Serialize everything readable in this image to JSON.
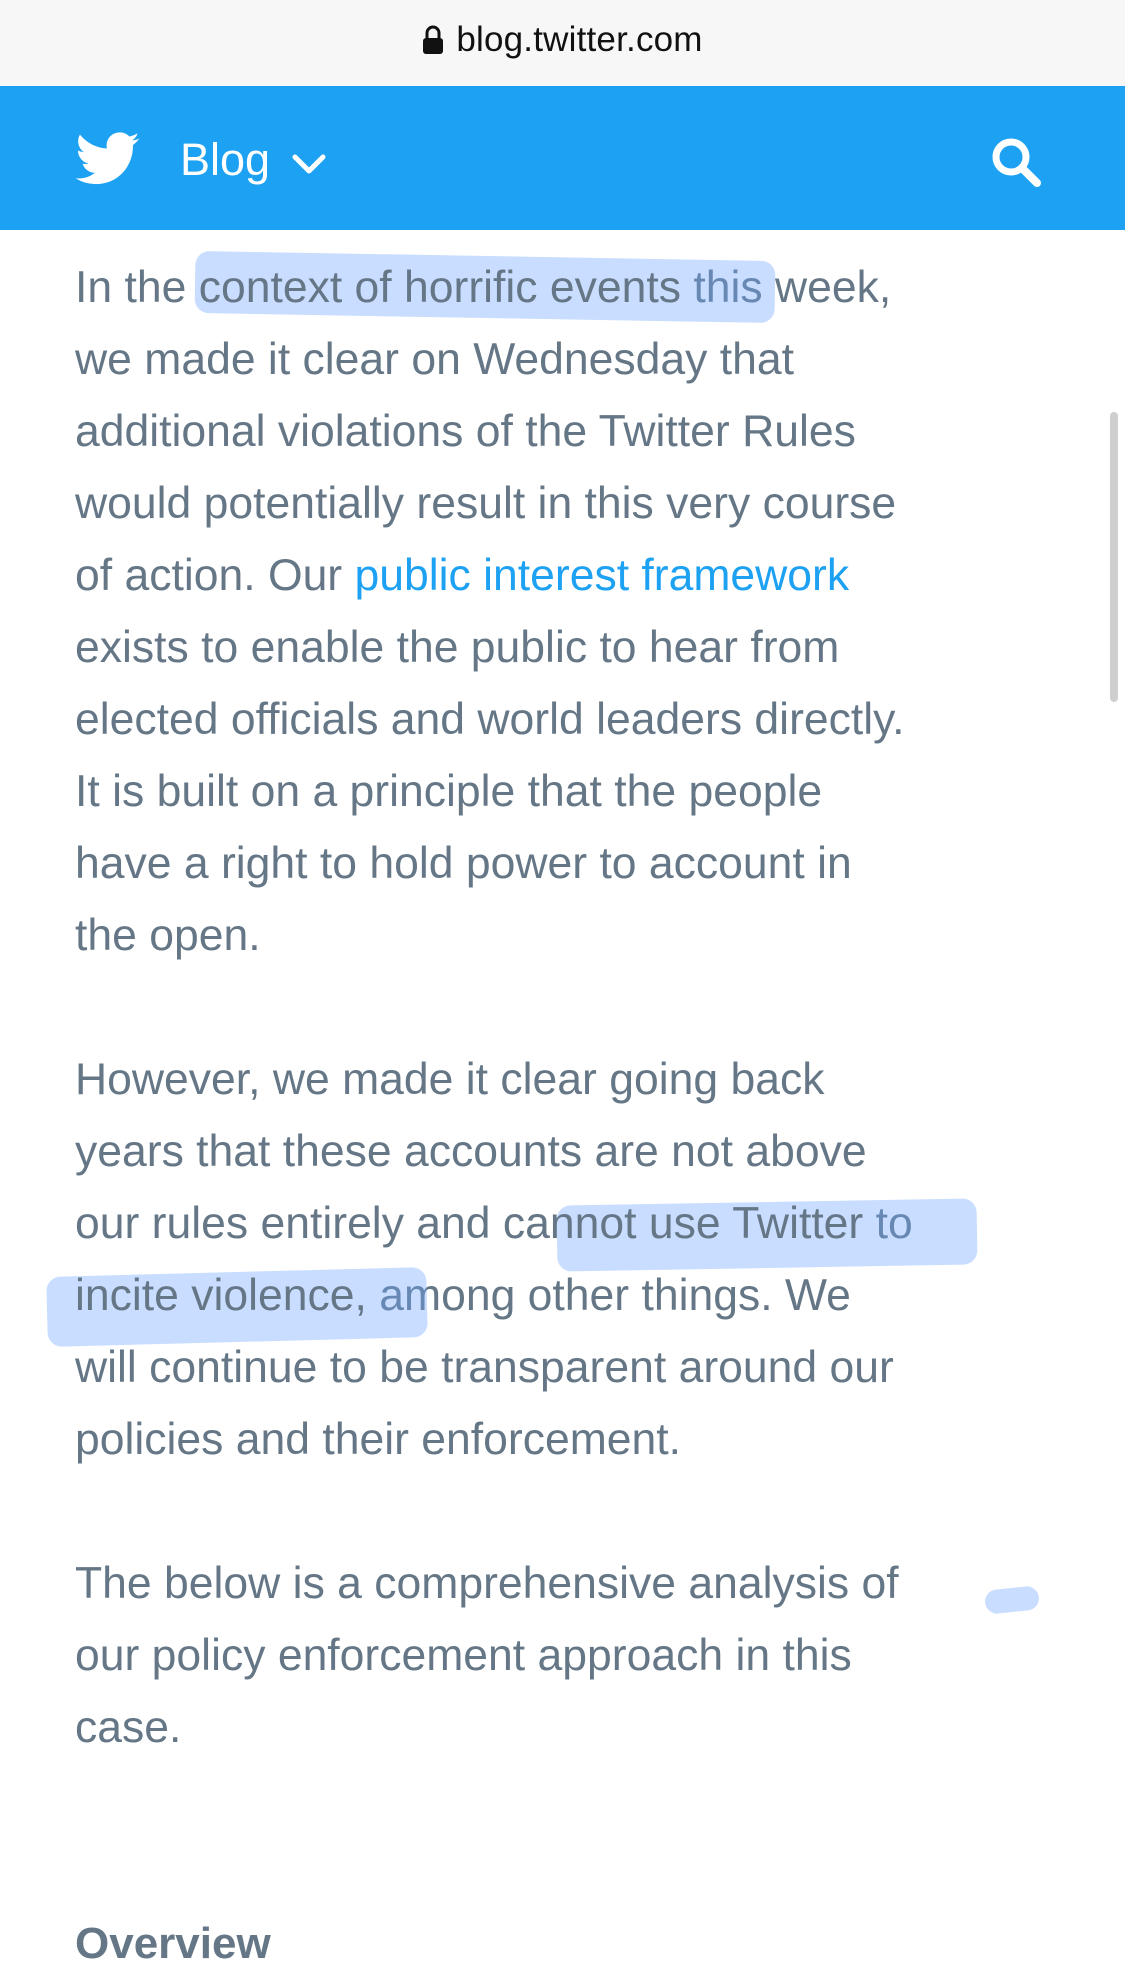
{
  "browser": {
    "url": "blog.twitter.com"
  },
  "header": {
    "nav_label": "Blog",
    "brand_color": "#1da1f2"
  },
  "article": {
    "p1": {
      "l1_a": "In the ",
      "l1_b": "context of horrific events",
      "l1_c": " this week,",
      "l2": "we made it clear on Wednesday that",
      "l3": "additional violations of the Twitter Rules",
      "l4": "would potentially result in this very course",
      "l5_a": "of action. Our ",
      "l5_link": "public interest framework",
      "l6": "exists to enable the public to hear from",
      "l7": "elected officials and world leaders directly.",
      "l8": "It is built on a principle that the people",
      "l9": "have a right to hold power to account in",
      "l10": "the open."
    },
    "p2": {
      "l1": "However, we made it clear going back",
      "l2": "years that these accounts are not above",
      "l3_a": "our rules entirely and ",
      "l3_b": "cannot use Twitter",
      "l3_c": " to",
      "l4_a": "incite violence,",
      "l4_b": " among other things. We",
      "l5": "will continue to be transparent around our",
      "l6": "policies and their enforcement."
    },
    "p3": {
      "l1": "The below is a comprehensive analysis of",
      "l2": "our policy enforcement approach in this",
      "l3": "case."
    },
    "heading": "Overview"
  }
}
